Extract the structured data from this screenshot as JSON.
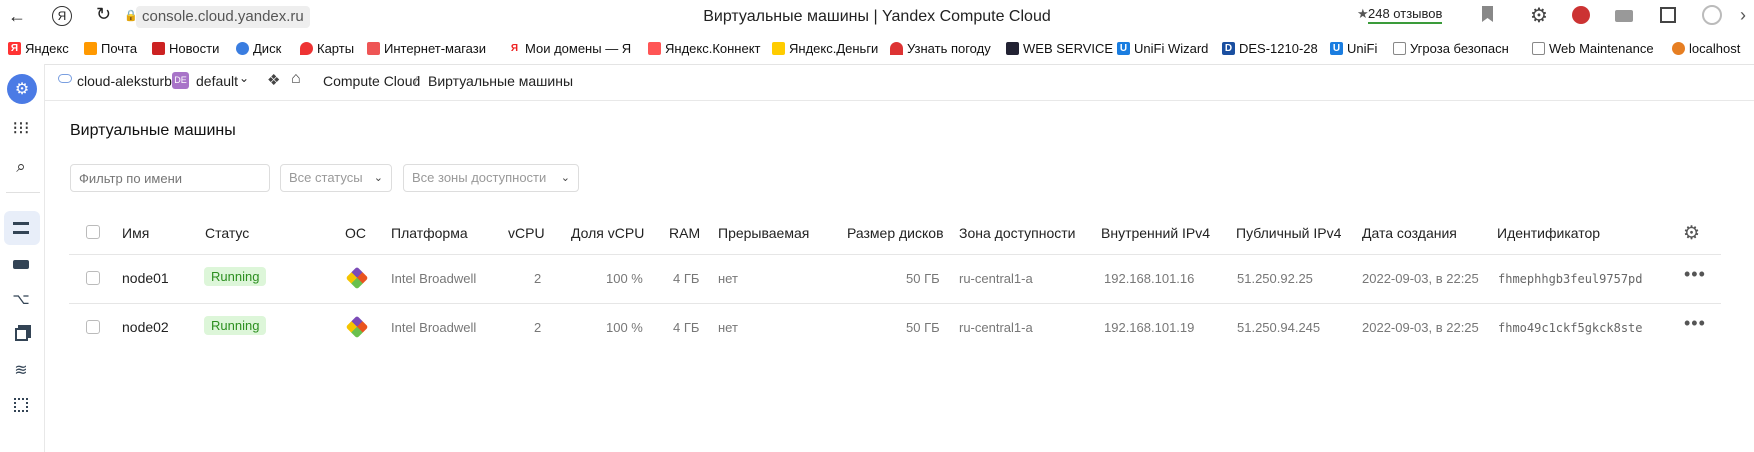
{
  "browser": {
    "url": "console.cloud.yandex.ru",
    "tab_title": "Виртуальные машины | Yandex Compute Cloud",
    "reviews": "248 отзывов",
    "bookmarks": [
      "Яндекс",
      "Почта",
      "Новости",
      "Диск",
      "Карты",
      "Интернет-магази",
      "Мои домены — Я",
      "Яндекс.Коннект",
      "Яндекс.Деньги",
      "Узнать погоду",
      "WEB SERVICE",
      "UniFi Wizard",
      "DES-1210-28",
      "UniFi",
      "Угроза безопасн",
      "Web Maintenance",
      "localhost"
    ]
  },
  "header": {
    "cloud": "cloud-aleksturbo",
    "folder_badge": "DE",
    "folder": "default",
    "breadcrumb_service": "Compute Cloud",
    "breadcrumb_sep": "/",
    "breadcrumb_page": "Виртуальные машины"
  },
  "page": {
    "title": "Виртуальные машины",
    "filter_placeholder": "Фильтр по имени",
    "status_filter": "Все статусы",
    "zone_filter": "Все зоны доступности"
  },
  "table": {
    "columns": [
      "Имя",
      "Статус",
      "ОС",
      "Платформа",
      "vCPU",
      "Доля vCPU",
      "RAM",
      "Прерываемая",
      "Размер дисков",
      "Зона доступности",
      "Внутренний IPv4",
      "Публичный IPv4",
      "Дата создания",
      "Идентификатор"
    ],
    "rows": [
      {
        "name": "node01",
        "status": "Running",
        "platform": "Intel Broadwell",
        "vcpu": "2",
        "vcpu_share": "100 %",
        "ram": "4 ГБ",
        "preemptible": "нет",
        "disk": "50 ГБ",
        "zone": "ru-central1-a",
        "internal_ip": "192.168.101.16",
        "public_ip": "51.250.92.25",
        "created": "2022-09-03, в 22:25",
        "id": "fhmephhgb3feul9757pd"
      },
      {
        "name": "node02",
        "status": "Running",
        "platform": "Intel Broadwell",
        "vcpu": "2",
        "vcpu_share": "100 %",
        "ram": "4 ГБ",
        "preemptible": "нет",
        "disk": "50 ГБ",
        "zone": "ru-central1-a",
        "internal_ip": "192.168.101.19",
        "public_ip": "51.250.94.245",
        "created": "2022-09-03, в 22:25",
        "id": "fhmo49c1ckf5gkck8ste"
      }
    ]
  },
  "colors": {
    "accent": "#4b7be5",
    "running_bg": "#ddf6d9",
    "running_fg": "#2c8f1f"
  }
}
